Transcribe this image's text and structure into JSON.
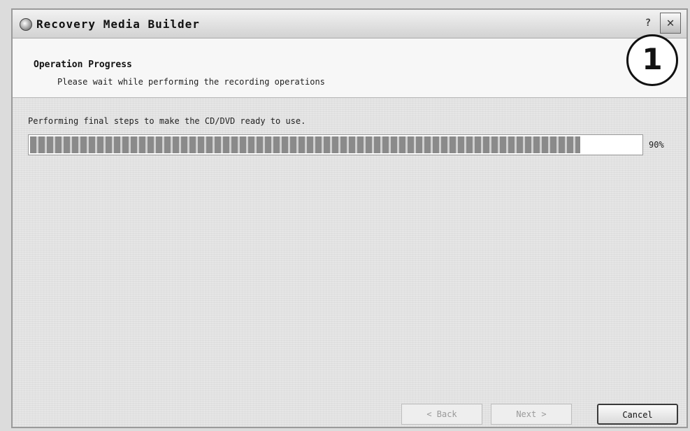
{
  "window": {
    "title": "Recovery Media Builder",
    "help_glyph": "?",
    "close_glyph": "✕"
  },
  "header": {
    "title": "Operation Progress",
    "subtitle": "Please wait while performing the recording operations",
    "callout_number": "1"
  },
  "progress": {
    "status_text": "Performing final steps to make the CD/DVD ready to use.",
    "value": 0.9,
    "label": "90%"
  },
  "buttons": {
    "back": "< Back",
    "next": "Next >",
    "cancel": "Cancel"
  }
}
